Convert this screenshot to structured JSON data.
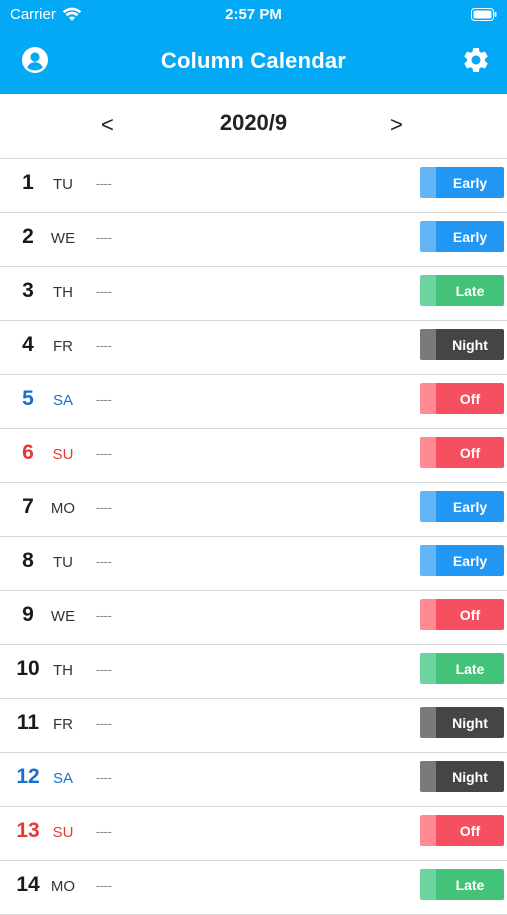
{
  "status_bar": {
    "carrier": "Carrier",
    "time": "2:57 PM"
  },
  "app_bar": {
    "title": "Column Calendar"
  },
  "month_nav": {
    "prev": "<",
    "month": "2020/9",
    "next": ">"
  },
  "shift_colors": {
    "Early": {
      "stripe": "#64b5f6",
      "main": "#2196f3"
    },
    "Late": {
      "stripe": "#6dd3a0",
      "main": "#43c27a"
    },
    "Night": {
      "stripe": "#7a7a7a",
      "main": "#454545"
    },
    "Off": {
      "stripe": "#ff8a93",
      "main": "#f4505f"
    }
  },
  "days": [
    {
      "num": "1",
      "dow": "TU",
      "memo": "----",
      "shift": "Early",
      "type": "weekday"
    },
    {
      "num": "2",
      "dow": "WE",
      "memo": "----",
      "shift": "Early",
      "type": "weekday"
    },
    {
      "num": "3",
      "dow": "TH",
      "memo": "----",
      "shift": "Late",
      "type": "weekday"
    },
    {
      "num": "4",
      "dow": "FR",
      "memo": "----",
      "shift": "Night",
      "type": "weekday"
    },
    {
      "num": "5",
      "dow": "SA",
      "memo": "----",
      "shift": "Off",
      "type": "sat"
    },
    {
      "num": "6",
      "dow": "SU",
      "memo": "----",
      "shift": "Off",
      "type": "sun"
    },
    {
      "num": "7",
      "dow": "MO",
      "memo": "----",
      "shift": "Early",
      "type": "weekday"
    },
    {
      "num": "8",
      "dow": "TU",
      "memo": "----",
      "shift": "Early",
      "type": "weekday"
    },
    {
      "num": "9",
      "dow": "WE",
      "memo": "----",
      "shift": "Off",
      "type": "weekday"
    },
    {
      "num": "10",
      "dow": "TH",
      "memo": "----",
      "shift": "Late",
      "type": "weekday"
    },
    {
      "num": "11",
      "dow": "FR",
      "memo": "----",
      "shift": "Night",
      "type": "weekday"
    },
    {
      "num": "12",
      "dow": "SA",
      "memo": "----",
      "shift": "Night",
      "type": "sat"
    },
    {
      "num": "13",
      "dow": "SU",
      "memo": "----",
      "shift": "Off",
      "type": "sun"
    },
    {
      "num": "14",
      "dow": "MO",
      "memo": "----",
      "shift": "Late",
      "type": "weekday"
    }
  ]
}
